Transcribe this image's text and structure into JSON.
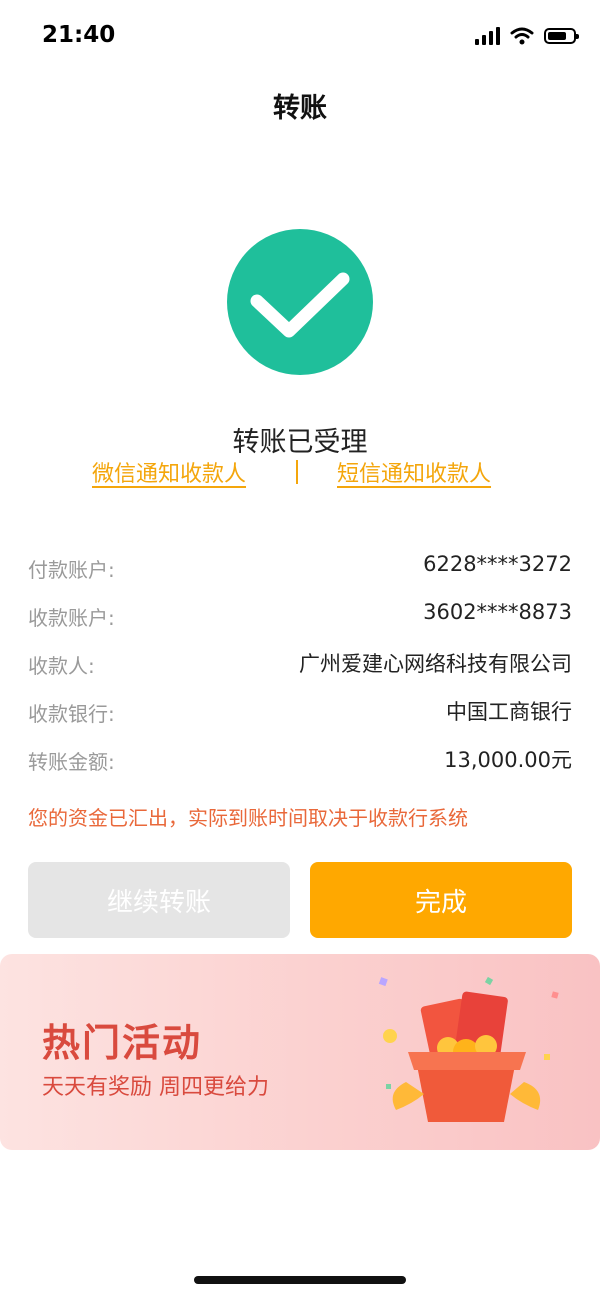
{
  "status_bar": {
    "time": "21:40"
  },
  "nav": {
    "title": "转账"
  },
  "result": {
    "title": "转账已受理",
    "notify_wechat": "微信通知收款人",
    "notify_sms": "短信通知收款人"
  },
  "details": [
    {
      "label": "付款账户:",
      "value": "6228****3272"
    },
    {
      "label": "收款账户:",
      "value": "3602****8873"
    },
    {
      "label": "收款人:",
      "value": "广州爱建心网络科技有限公司"
    },
    {
      "label": "收款银行:",
      "value": "中国工商银行"
    },
    {
      "label": "转账金额:",
      "value": "13,000.00元"
    }
  ],
  "notice": "您的资金已汇出，实际到账时间取决于收款行系统",
  "buttons": {
    "continue": "继续转账",
    "done": "完成"
  },
  "promo": {
    "title": "热门活动",
    "subtitle": "天天有奖励  周四更给力"
  },
  "colors": {
    "success": "#1fbf9b",
    "accent": "#ffa800",
    "link": "#f4a60c",
    "notice": "#e9683a",
    "promo_text": "#d94a3e"
  },
  "icons": [
    "signal-icon",
    "wifi-icon",
    "battery-icon",
    "check-circle-icon",
    "gift-box-icon"
  ]
}
